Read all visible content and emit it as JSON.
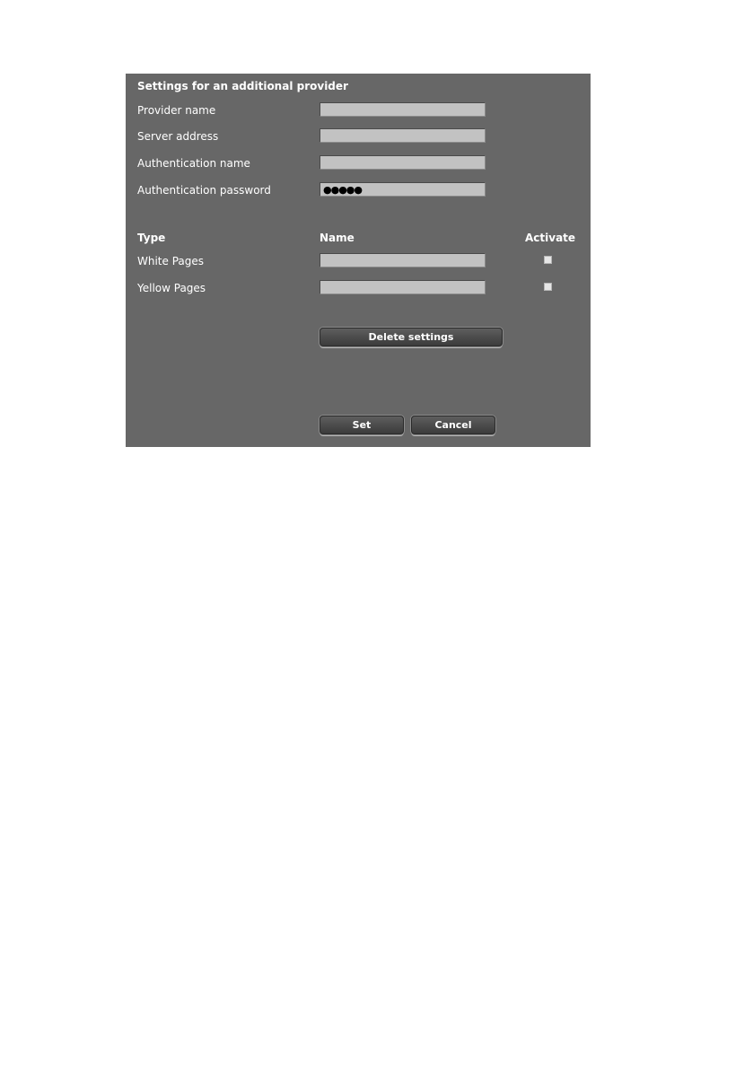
{
  "dialog": {
    "title": "Settings for an additional provider",
    "fields": {
      "provider_name": {
        "label": "Provider name",
        "value": ""
      },
      "server_address": {
        "label": "Server address",
        "value": ""
      },
      "auth_name": {
        "label": "Authentication name",
        "value": ""
      },
      "auth_password": {
        "label": "Authentication password",
        "value": "●●●●●"
      }
    },
    "table": {
      "headers": {
        "type": "Type",
        "name": "Name",
        "activate": "Activate"
      },
      "rows": [
        {
          "type": "White Pages",
          "name": "",
          "activated": false
        },
        {
          "type": "Yellow Pages",
          "name": "",
          "activated": false
        }
      ]
    },
    "buttons": {
      "delete": "Delete settings",
      "set": "Set",
      "cancel": "Cancel"
    },
    "colors": {
      "panel_bg": "#676767",
      "field_bg": "#c2c2c2",
      "button_bg": "#4a4a4a"
    }
  }
}
